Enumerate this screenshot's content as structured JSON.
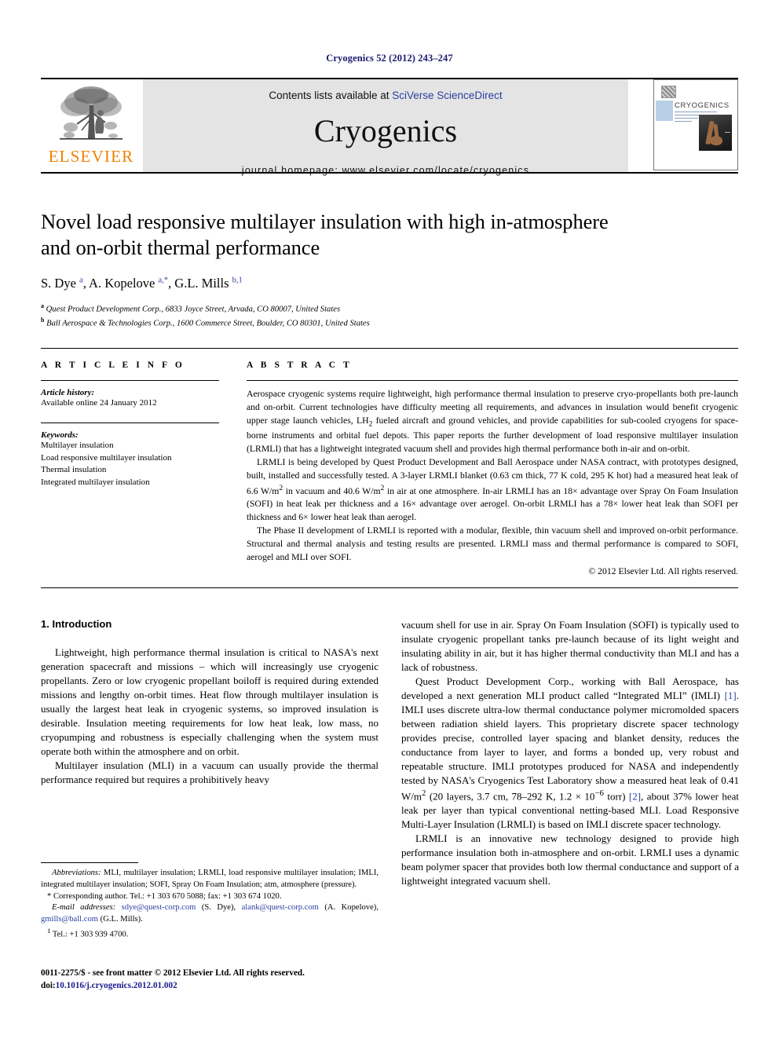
{
  "running_head": "Cryogenics 52 (2012) 243–247",
  "masthead": {
    "publisher_wordmark": "ELSEVIER",
    "contents_prefix": "Contents lists available at ",
    "contents_link": "SciVerse ScienceDirect",
    "journal_name": "Cryogenics",
    "homepage": "journal homepage: www.elsevier.com/locate/cryogenics",
    "cover_title": "CRYOGENICS"
  },
  "article": {
    "title_line1": "Novel load responsive multilayer insulation with high in-atmosphere",
    "title_line2": "and on-orbit thermal performance",
    "authors_html": "S. Dye <sup>a</sup>, A. Kopelove <sup>a,*</sup>, G.L. Mills <sup>b,1</sup>",
    "affiliation_a": "Quest Product Development Corp., 6833 Joyce Street, Arvada, CO 80007, United States",
    "affiliation_b": "Ball Aerospace & Technologies Corp., 1600 Commerce Street, Boulder, CO 80301, United States"
  },
  "article_info": {
    "heading": "A R T I C L E    I N F O",
    "history_label": "Article history:",
    "history_value": "Available online 24 January 2012",
    "keywords_label": "Keywords:",
    "keywords": [
      "Multilayer insulation",
      "Load responsive multilayer insulation",
      "Thermal insulation",
      "Integrated multilayer insulation"
    ]
  },
  "abstract": {
    "heading": "A B S T R A C T",
    "paragraphs": [
      "Aerospace cryogenic systems require lightweight, high performance thermal insulation to preserve cryo-propellants both pre-launch and on-orbit. Current technologies have difficulty meeting all requirements, and advances in insulation would benefit cryogenic upper stage launch vehicles, LH2 fueled aircraft and ground vehicles, and provide capabilities for sub-cooled cryogens for space-borne instruments and orbital fuel depots. This paper reports the further development of load responsive multilayer insulation (LRMLI) that has a lightweight integrated vacuum shell and provides high thermal performance both in-air and on-orbit.",
      "LRMLI is being developed by Quest Product Development and Ball Aerospace under NASA contract, with prototypes designed, built, installed and successfully tested. A 3-layer LRMLI blanket (0.63 cm thick, 77 K cold, 295 K hot) had a measured heat leak of 6.6 W/m2 in vacuum and 40.6 W/m2 in air at one atmosphere. In-air LRMLI has an 18× advantage over Spray On Foam Insulation (SOFI) in heat leak per thickness and a 16× advantage over aerogel. On-orbit LRMLI has a 78× lower heat leak than SOFI per thickness and 6× lower heat leak than aerogel.",
      "The Phase II development of LRMLI is reported with a modular, flexible, thin vacuum shell and improved on-orbit performance. Structural and thermal analysis and testing results are presented. LRMLI mass and thermal performance is compared to SOFI, aerogel and MLI over SOFI."
    ],
    "copyright": "© 2012 Elsevier Ltd. All rights reserved."
  },
  "introduction": {
    "section_number_title": "1. Introduction",
    "left_paragraphs": [
      "Lightweight, high performance thermal insulation is critical to NASA's next generation spacecraft and missions – which will increasingly use cryogenic propellants. Zero or low cryogenic propellant boiloff is required during extended missions and lengthy on-orbit times. Heat flow through multilayer insulation is usually the largest heat leak in cryogenic systems, so improved insulation is desirable. Insulation meeting requirements for low heat leak, low mass, no cryopumping and robustness is especially challenging when the system must operate both within the atmosphere and on orbit.",
      "Multilayer insulation (MLI) in a vacuum can usually provide the thermal performance required but requires a prohibitively heavy"
    ],
    "right_paragraphs": [
      "vacuum shell for use in air. Spray On Foam Insulation (SOFI) is typically used to insulate cryogenic propellant tanks pre-launch because of its light weight and insulating ability in air, but it has higher thermal conductivity than MLI and has a lack of robustness.",
      "Quest Product Development Corp., working with Ball Aerospace, has developed a next generation MLI product called “Integrated MLI” (IMLI) [1]. IMLI uses discrete ultra-low thermal conductance polymer micromolded spacers between radiation shield layers. This proprietary discrete spacer technology provides precise, controlled layer spacing and blanket density, reduces the conductance from layer to layer, and forms a bonded up, very robust and repeatable structure. IMLI prototypes produced for NASA and independently tested by NASA's Cryogenics Test Laboratory show a measured heat leak of 0.41 W/m2 (20 layers, 3.7 cm, 78–292 K, 1.2 × 10−6 torr) [2], about 37% lower heat leak per layer than typical conventional netting-based MLI. Load Responsive Multi-Layer Insulation (LRMLI) is based on IMLI discrete spacer technology.",
      "LRMLI is an innovative new technology designed to provide high performance insulation both in-atmosphere and on-orbit. LRMLI uses a dynamic beam polymer spacer that provides both low thermal conductance and support of a lightweight integrated vacuum shell."
    ]
  },
  "footnotes": {
    "abbreviations_label": "Abbreviations:",
    "abbreviations_text": " MLI, multilayer insulation; LRMLI, load responsive multilayer insulation; IMLI, integrated multilayer insulation; SOFI, Spray On Foam Insulation; atm, atmosphere (pressure).",
    "corresponding_marker": "*",
    "corresponding_text": " Corresponding author. Tel.: +1 303 670 5088; fax: +1 303 674 1020.",
    "email_label": "E-mail addresses:",
    "email_1": "sdye@quest-corp.com",
    "email_1_who": " (S. Dye), ",
    "email_2": "alank@quest-corp.com",
    "email_2_who": " (A. Kopelove), ",
    "email_3": "gmills@ball.com",
    "email_3_who": " (G.L. Mills).",
    "tel_marker": "1",
    "tel_text": " Tel.: +1 303 939 4700."
  },
  "issn_footer": {
    "line1": "0011-2275/$ - see front matter © 2012 Elsevier Ltd. All rights reserved.",
    "doi_label": "doi:",
    "doi_value": "10.1016/j.cryogenics.2012.01.002"
  },
  "colors": {
    "link_blue": "#2b3fa0",
    "running_head_navy": "#1a1a6e",
    "elsevier_orange": "#f08000",
    "masthead_grey": "#e4e4e4"
  }
}
